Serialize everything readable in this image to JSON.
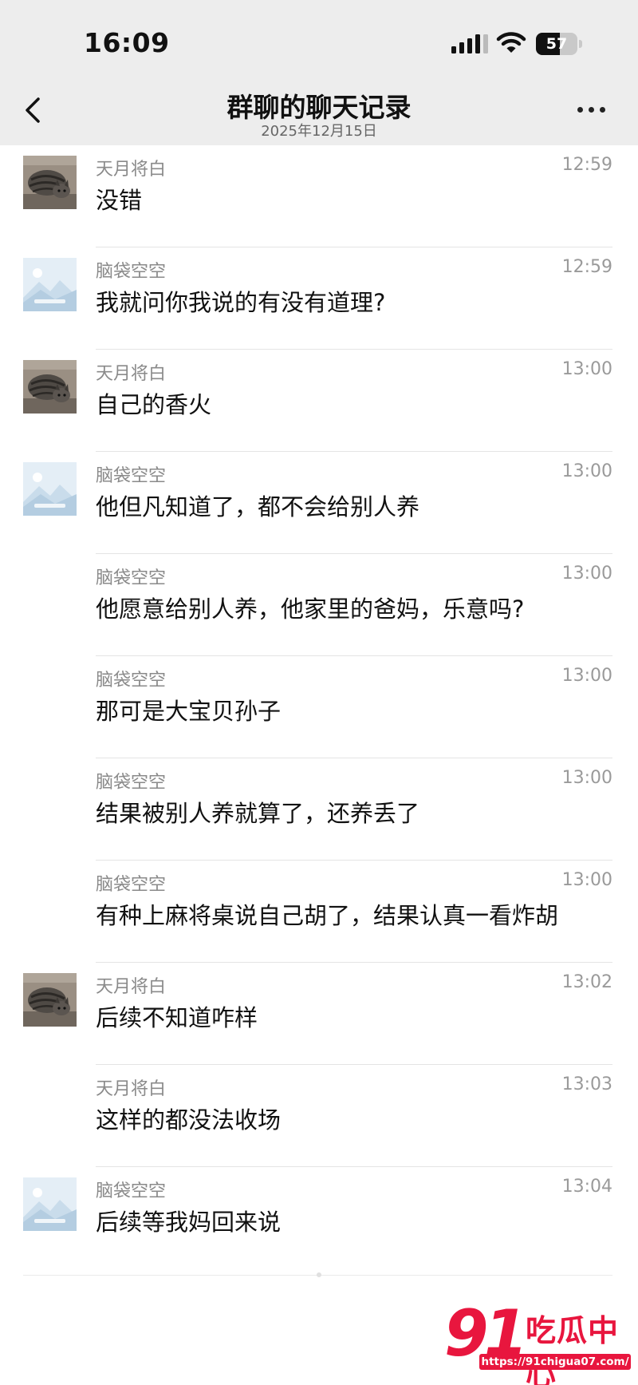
{
  "status_bar": {
    "time": "16:09",
    "battery_level": "57"
  },
  "header": {
    "title": "群聊的聊天记录",
    "date": "2025年12月15日"
  },
  "messages": [
    {
      "sender": "天月将白",
      "time": "12:59",
      "text": "没错",
      "avatar": "cat"
    },
    {
      "sender": "脑袋空空",
      "time": "12:59",
      "text": "我就问你我说的有没有道理?",
      "avatar": "placeholder"
    },
    {
      "sender": "天月将白",
      "time": "13:00",
      "text": "自己的香火",
      "avatar": "cat"
    },
    {
      "sender": "脑袋空空",
      "time": "13:00",
      "text": "他但凡知道了，都不会给别人养",
      "avatar": "placeholder"
    },
    {
      "sender": "脑袋空空",
      "time": "13:00",
      "text": "他愿意给别人养，他家里的爸妈，乐意吗?",
      "avatar": "none"
    },
    {
      "sender": "脑袋空空",
      "time": "13:00",
      "text": "那可是大宝贝孙子",
      "avatar": "none"
    },
    {
      "sender": "脑袋空空",
      "time": "13:00",
      "text": "结果被别人养就算了，还养丢了",
      "avatar": "none"
    },
    {
      "sender": "脑袋空空",
      "time": "13:00",
      "text": "有种上麻将桌说自己胡了，结果认真一看炸胡",
      "avatar": "none"
    },
    {
      "sender": "天月将白",
      "time": "13:02",
      "text": "后续不知道咋样",
      "avatar": "cat"
    },
    {
      "sender": "天月将白",
      "time": "13:03",
      "text": "这样的都没法收场",
      "avatar": "none"
    },
    {
      "sender": "脑袋空空",
      "time": "13:04",
      "text": "后续等我妈回来说",
      "avatar": "placeholder"
    }
  ],
  "watermark": {
    "number": "91",
    "name": "吃瓜中心",
    "url": "https://91chigua07.com/"
  },
  "colors": {
    "watermark": "#e8163e",
    "header_bg": "#ededed"
  }
}
